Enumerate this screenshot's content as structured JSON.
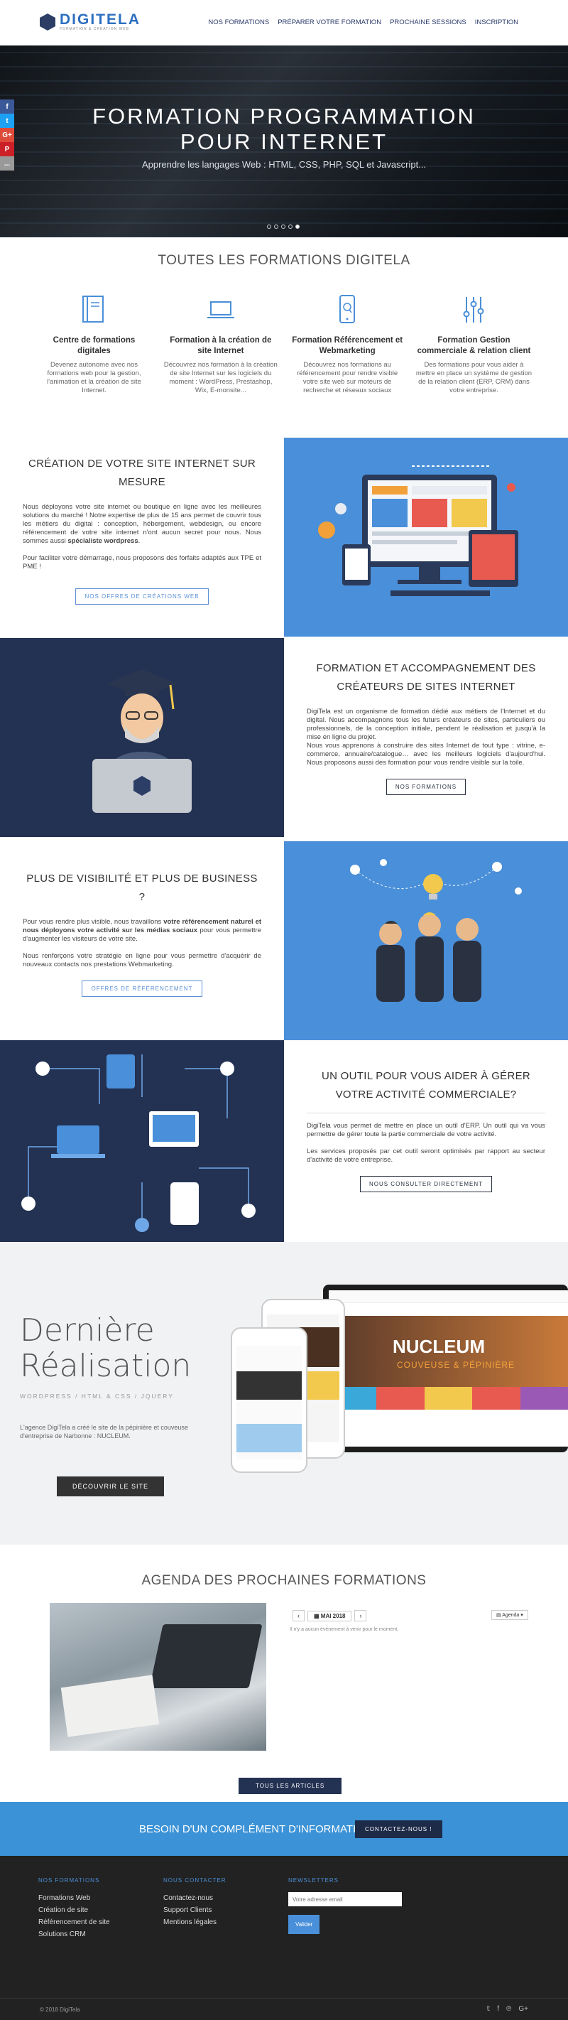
{
  "header": {
    "logo_text": "DIGITELA",
    "logo_sub": "FORMATION & CRÉATION WEB",
    "nav": [
      "NOS FORMATIONS",
      "PRÉPARER VOTRE FORMATION",
      "PROCHAINE SESSIONS",
      "INSCRIPTION"
    ]
  },
  "hero": {
    "title_line1": "FORMATION PROGRAMMATION",
    "title_line2": "POUR INTERNET",
    "subtitle": "Apprendre les langages Web : HTML, CSS, PHP, SQL et Javascript...",
    "slides": 5,
    "active_slide": 5
  },
  "social_sidebar": {
    "facebook": "f",
    "twitter": "t",
    "google": "G+",
    "pinterest": "P",
    "more": "..."
  },
  "formations": {
    "title": "TOUTES LES FORMATIONS DIGITELA",
    "cards": [
      {
        "title": "Centre de formations digitales",
        "text": "Devenez autonome avec nos formations web pour la gestion, l'animation et la création de site Internet."
      },
      {
        "title": "Formation à la création de site Internet",
        "text": "Découvrez nos formation à la création de site Internet sur les logiciels du moment : WordPress, Prestashop, Wix, E-monsite..."
      },
      {
        "title": "Formation Référencement et Webmarketing",
        "text": "Découvrez nos formations au référencement pour rendre visible votre site web sur moteurs de recherche et réseaux sociaux"
      },
      {
        "title": "Formation Gestion commerciale & relation client",
        "text": "Des formations pour vous aider à mettre en place un système de gestion de la relation client (ERP, CRM) dans votre entreprise."
      }
    ]
  },
  "creation": {
    "title": "CRÉATION DE VOTRE SITE INTERNET SUR MESURE",
    "p1": "Nous déployons votre site internet ou boutique en ligne avec les meilleures solutions du marché ! Notre expertise de plus de 15 ans permet de couvrir tous les métiers du digital : conception, hébergement, webdesign, ou encore référencement de votre site internet n'ont aucun secret pour nous. Nous sommes aussi",
    "p1_bold": "spécialiste wordpress",
    "p2": "Pour faciliter votre démarrage, nous proposons des forfaits adaptés aux TPE et PME !",
    "button": "NOS OFFRES DE CRÉATIONS WEB"
  },
  "accompagnement": {
    "title": "FORMATION ET ACCOMPAGNEMENT DES CRÉATEURS DE SITES INTERNET",
    "p1": "DigiTela est un organisme de formation dédié aux métiers de l'Internet et du digital. Nous accompagnons tous les futurs créateurs de sites, particuliers ou professionnels, de la conception initiale, pendent le réalisation et jusqu'à la mise en ligne du projet.",
    "p2": "Nous vous apprenons à construire des sites Internet de tout type : vitrine, e-commerce, annuaire/catalogue… avec les meilleurs logiciels d'aujourd'hui. Nous proposons aussi des formation pour vous rendre visible sur la toile.",
    "button": "NOS FORMATIONS"
  },
  "visibilite": {
    "title": "PLUS DE VISIBILITÉ ET PLUS DE BUSINESS ?",
    "p1_start": "Pour vous rendre plus visible, nous travaillons",
    "p1_bold": "votre référencement naturel et nous déployons votre activité sur les médias sociaux",
    "p1_end": "pour vous permettre d'augmenter les visiteurs de votre site.",
    "p2": "Nous renforçons votre stratégie en ligne pour vous permettre d'acquérir de nouveaux contacts nos prestations Webmarketing.",
    "button": "OFFRES DE RÉFÉRENCEMENT"
  },
  "outil": {
    "title": "UN OUTIL POUR VOUS AIDER À GÉRER VOTRE ACTIVITÉ COMMERCIALE?",
    "p1": "DigiTela vous permet de mettre en place un outil d'ERP. Un outil qui va vous permettre de gérer toute la partie commerciale de votre activité.",
    "p2": "Les services proposés par cet outil seront optimisés par rapport au secteur d'activité de votre entreprise.",
    "button": "NOUS CONSULTER DIRECTEMENT"
  },
  "realisation": {
    "title_line1": "Dernière",
    "title_line2": "Réalisation",
    "tags": "WORDPRESS / HTML & CSS / JQUERY",
    "text": "L'agence DigiTela a créé le site de la pépinière et couveuse d'entreprise de Narbonne : NUCLEUM.",
    "button": "DÉCOUVRIR LE SITE",
    "mock_brand": "NUCLEUM",
    "mock_sub": "COUVEUSE & PÉPINIÈRE"
  },
  "agenda": {
    "title": "AGENDA DES PROCHAINES FORMATIONS",
    "month": "MAI 2018",
    "view": "Agenda",
    "empty": "Il n'y a aucun événement à venir pour le moment.",
    "button": "TOUS LES ARTICLES"
  },
  "cta": {
    "text": "BESOIN D'UN COMPLÉMENT D'INFORMATION ?",
    "button": "CONTACTEZ-NOUS !"
  },
  "footer": {
    "col1_title": "NOS FORMATIONS",
    "col1": [
      "Formations Web",
      "Création de site",
      "Référencement de site",
      "Solutions CRM"
    ],
    "col2_title": "NOUS CONTACTER",
    "col2": [
      "Contactez-nous",
      "Support Clients",
      "Mentions légales"
    ],
    "col3_title": "NEWSLETTERS",
    "email_placeholder": "Votre adresse email",
    "submit": "Valider",
    "copyright": "© 2018 DigiTela"
  },
  "colors": {
    "primary_blue": "#4a8fd9",
    "navy": "#233152",
    "footer": "#222222"
  }
}
